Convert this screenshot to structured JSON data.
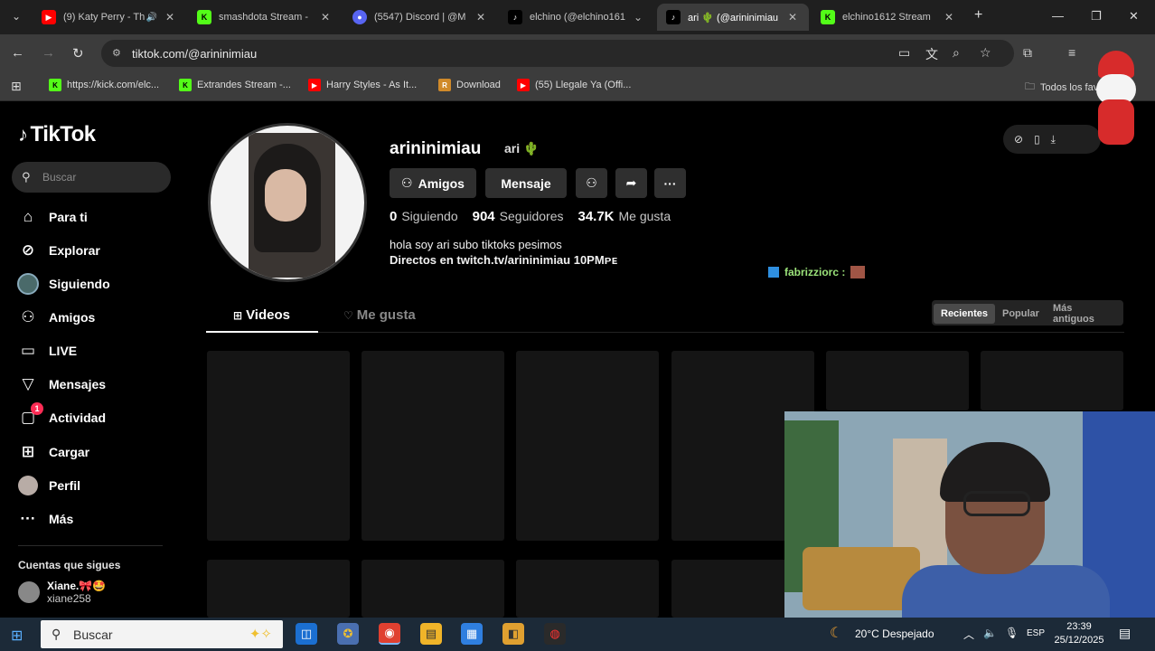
{
  "browser": {
    "tabs": [
      {
        "title": "(9) Katy Perry - Th",
        "favicon": "youtube-icon",
        "active": false
      },
      {
        "title": "smashdota Stream - ",
        "favicon": "kick-icon",
        "active": false
      },
      {
        "title": "(5547) Discord | @M",
        "favicon": "discord-icon",
        "active": false
      },
      {
        "title": "elchino (@elchino161",
        "favicon": "tiktok-icon",
        "active": false
      },
      {
        "title": "ari 🌵 (@arininimiau",
        "favicon": "tiktok-icon",
        "active": true
      },
      {
        "title": "elchino1612 Stream ",
        "favicon": "kick-icon",
        "active": false
      }
    ],
    "new_tab_label": "+",
    "url": "tiktok.com/@arininimiau",
    "bookmarks": [
      {
        "label": "https://kick.com/elc...",
        "favicon": "kick-icon"
      },
      {
        "label": "Extrandes Stream -...",
        "favicon": "kick-icon"
      },
      {
        "label": "Harry Styles - As It...",
        "favicon": "youtube-icon"
      },
      {
        "label": "Download",
        "favicon": "r-icon"
      },
      {
        "label": "(55) Llegale Ya (Offi...",
        "favicon": "youtube-icon"
      }
    ],
    "all_bookmarks_label": "Todos los favoritos"
  },
  "tiktok": {
    "logo_text": "TikTok",
    "search_placeholder": "Buscar",
    "nav": [
      {
        "label": "Para ti",
        "icon": "home-icon"
      },
      {
        "label": "Explorar",
        "icon": "compass-icon"
      },
      {
        "label": "Siguiendo",
        "icon": "following-avatar-icon"
      },
      {
        "label": "Amigos",
        "icon": "friends-icon"
      },
      {
        "label": "LIVE",
        "icon": "live-icon"
      },
      {
        "label": "Mensajes",
        "icon": "send-icon"
      },
      {
        "label": "Actividad",
        "icon": "inbox-icon",
        "badge": "1"
      },
      {
        "label": "Cargar",
        "icon": "upload-icon"
      },
      {
        "label": "Perfil",
        "icon": "profile-avatar-icon"
      },
      {
        "label": "Más",
        "icon": "more-icon"
      }
    ],
    "following_heading": "Cuentas que sigues",
    "following_account": {
      "display": "Xiane.🎀🤩",
      "handle": "xiane258"
    },
    "profile": {
      "username": "arininimiau",
      "nickname": "ari 🌵",
      "btn_friends": "Amigos",
      "btn_message": "Mensaje",
      "stats": {
        "following_count": "0",
        "following_label": "Siguiendo",
        "followers_count": "904",
        "followers_label": "Seguidores",
        "likes_count": "34.7K",
        "likes_label": "Me gusta"
      },
      "bio_line1": "hola soy ari subo tiktoks pesimos",
      "bio_line2": "Directos en twitch.tv/arininimiau 10PMᴘᴇ"
    },
    "ticker_text": "fabrizziorc :",
    "tabs": {
      "videos": "Videos",
      "likes": "Me gusta"
    },
    "sort": {
      "recent": "Recientes",
      "popular": "Popular",
      "oldest": "Más antiguos"
    }
  },
  "taskbar": {
    "search_placeholder": "Buscar",
    "weather": "20°C  Despejado",
    "lang": "ESP",
    "time": "23:39",
    "date": "25/12/2025"
  },
  "colors": {
    "tiktok_red": "#fe2c55",
    "background": "#000000",
    "chrome_tabbar": "#1f1f1f"
  }
}
